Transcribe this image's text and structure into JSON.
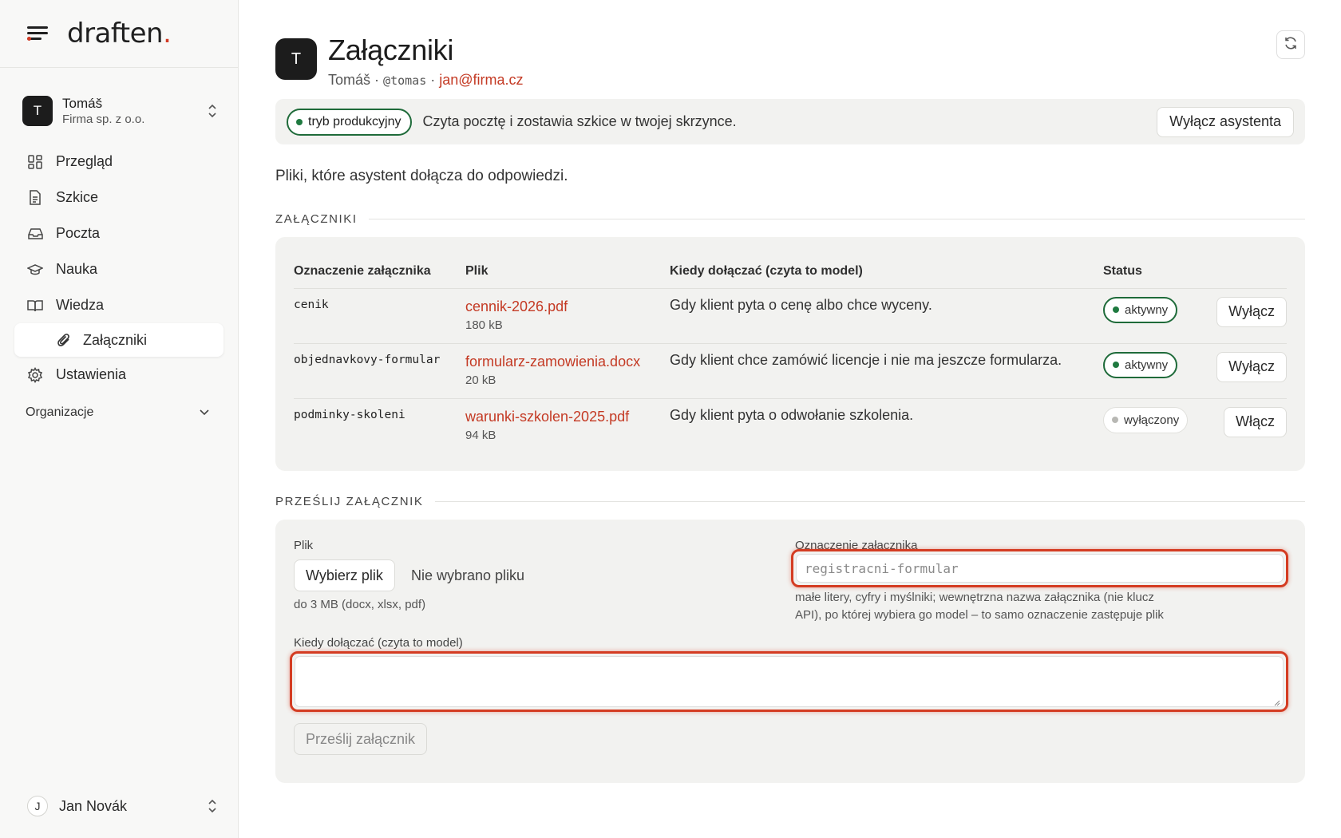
{
  "app": {
    "brand": "draften",
    "brand_accent": ".",
    "accent_color": "#d23a24"
  },
  "sidebar": {
    "org": {
      "initial": "T",
      "name": "Tomáš",
      "company": "Firma sp. z o.o."
    },
    "items": [
      {
        "label": "Przegląd",
        "icon": "grid-icon"
      },
      {
        "label": "Szkice",
        "icon": "document-icon"
      },
      {
        "label": "Poczta",
        "icon": "inbox-icon"
      },
      {
        "label": "Nauka",
        "icon": "graduation-cap-icon"
      },
      {
        "label": "Wiedza",
        "icon": "book-icon"
      },
      {
        "label": "Załączniki",
        "icon": "paperclip-icon",
        "active": true
      },
      {
        "label": "Ustawienia",
        "icon": "gear-icon"
      }
    ],
    "section_label": "Organizacje",
    "user": {
      "initial": "J",
      "name": "Jan Novák"
    }
  },
  "header": {
    "avatar_initial": "T",
    "title": "Załączniki",
    "name": "Tomáš",
    "separator": "·",
    "handle": "@tomas",
    "email": "jan@firma.cz"
  },
  "banner": {
    "mode": "tryb produkcyjny",
    "text": "Czyta pocztę i zostawia szkice w twojej skrzynce.",
    "button": "Wyłącz asystenta"
  },
  "intro": "Pliki, które asystent dołącza do odpowiedzi.",
  "attachments": {
    "section_title": "ZAŁĄCZNIKI",
    "columns": [
      "Oznaczenie załącznika",
      "Plik",
      "Kiedy dołączać (czyta to model)",
      "Status",
      ""
    ],
    "rows": [
      {
        "slug": "cenik",
        "file": "cennik-2026.pdf",
        "size": "180 kB",
        "when": "Gdy klient pyta o cenę albo chce wyceny.",
        "status": "aktywny",
        "active": true,
        "action": "Wyłącz"
      },
      {
        "slug": "objednavkovy-formular",
        "file": "formularz-zamowienia.docx",
        "size": "20 kB",
        "when": "Gdy klient chce zamówić licencje i nie ma jeszcze formularza.",
        "status": "aktywny",
        "active": true,
        "action": "Wyłącz"
      },
      {
        "slug": "podminky-skoleni",
        "file": "warunki-szkolen-2025.pdf",
        "size": "94 kB",
        "when": "Gdy klient pyta o odwołanie szkolenia.",
        "status": "wyłączony",
        "active": false,
        "action": "Włącz"
      }
    ]
  },
  "upload": {
    "section_title": "PRZEŚLIJ ZAŁĄCZNIK",
    "file_label": "Plik",
    "file_button": "Wybierz plik",
    "file_none": "Nie wybrano pliku",
    "file_hint": "do 3 MB (docx, xlsx, pdf)",
    "slug_label": "Oznaczenie załącznika",
    "slug_placeholder": "registracni-formular",
    "slug_value": "",
    "slug_hint_1": "małe litery, cyfry i myślniki; wewnętrzna nazwa załącznika (nie klucz",
    "slug_hint_2": "API), po której wybiera go model – to samo oznaczenie zastępuje plik",
    "when_label": "Kiedy dołączać (czyta to model)",
    "when_value": "",
    "submit": "Prześlij załącznik",
    "error_color": "#d43c22"
  }
}
